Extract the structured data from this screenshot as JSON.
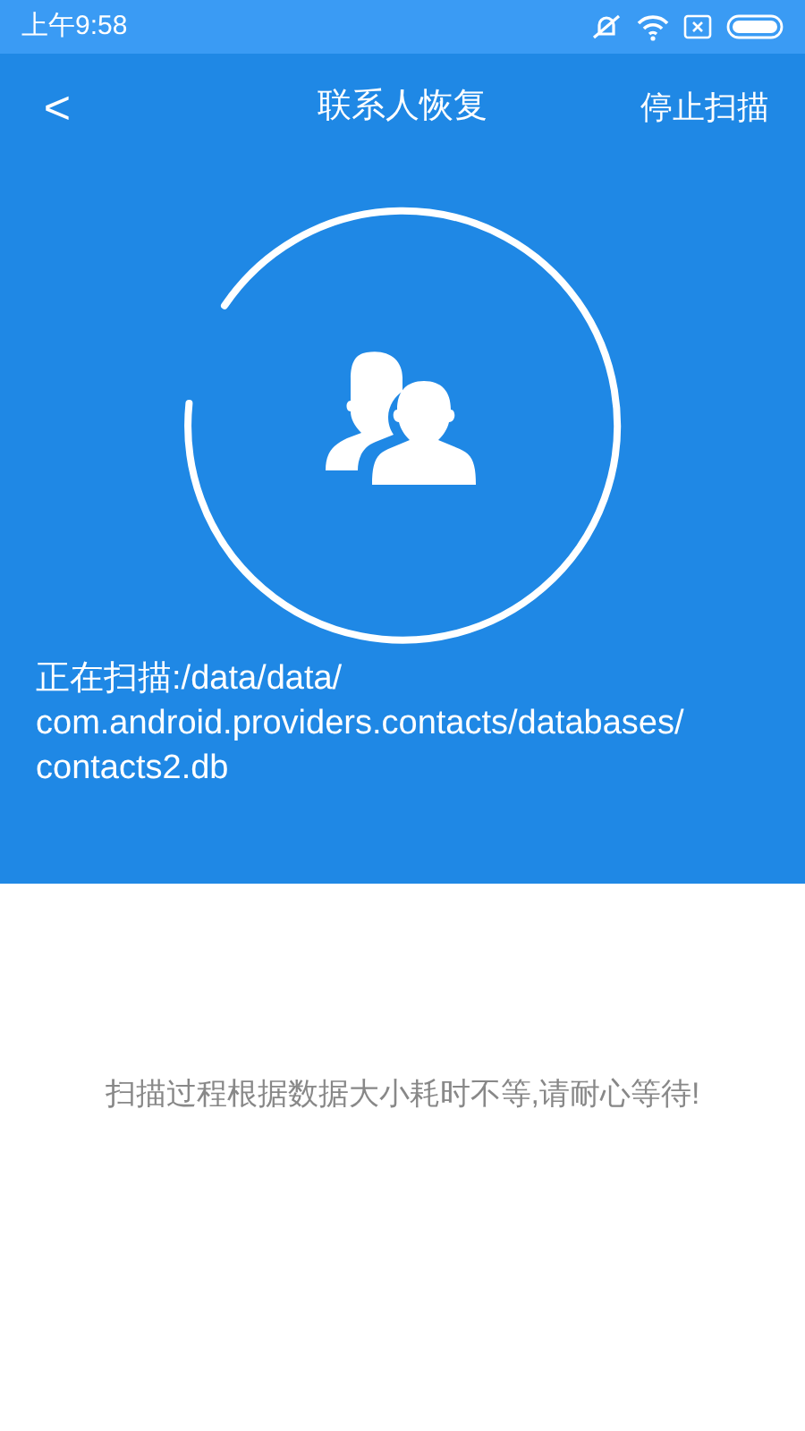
{
  "status_bar": {
    "time": "上午9:58"
  },
  "header": {
    "back": "<",
    "title": "联系人恢复",
    "action": "停止扫描"
  },
  "scan": {
    "label": "正在扫描:/data/data/com.android.providers.contacts/databases/contacts2.db"
  },
  "hint": "扫描过程根据数据大小耗时不等,请耐心等待!"
}
